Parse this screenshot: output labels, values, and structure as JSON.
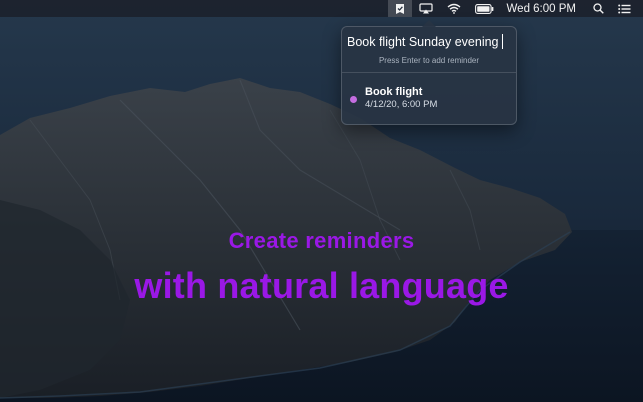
{
  "menubar": {
    "icons": [
      "reminders-app-icon",
      "airplay-icon",
      "wifi-icon",
      "battery-icon",
      "search-icon",
      "list-icon"
    ],
    "clock": "Wed 6:00 PM"
  },
  "popover": {
    "input_value": "Book flight Sunday evening",
    "hint": "Press Enter to add reminder",
    "reminder": {
      "title": "Book flight",
      "date": "4/12/20, 6:00 PM",
      "dot_color": "#c46de0"
    }
  },
  "captions": {
    "line1": "Create reminders",
    "line2": "with natural language",
    "color": "#9a18e6"
  }
}
